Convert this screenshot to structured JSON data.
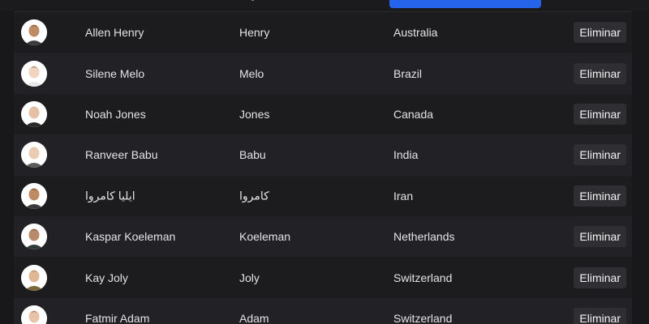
{
  "table": {
    "rows": [
      {
        "name": "Allen Henry",
        "last_name": "Henry",
        "country": "Australia",
        "delete_label": "Eliminar",
        "avatar": {
          "skin": "#c08a62",
          "hair": "#1a1a1a",
          "shirt": "#3a3a3a",
          "bg": "#ffffff"
        }
      },
      {
        "name": "Silene Melo",
        "last_name": "Melo",
        "country": "Brazil",
        "delete_label": "Eliminar",
        "avatar": {
          "skin": "#f1d3bf",
          "hair": "#141414",
          "shirt": "#e8e8e8",
          "bg": "#ffffff"
        }
      },
      {
        "name": "Noah Jones",
        "last_name": "Jones",
        "country": "Canada",
        "delete_label": "Eliminar",
        "avatar": {
          "skin": "#e6c0a4",
          "hair": "#b9b2a8",
          "shirt": "#2a2a2a",
          "bg": "#ffffff"
        }
      },
      {
        "name": "Ranveer Babu",
        "last_name": "Babu",
        "country": "India",
        "delete_label": "Eliminar",
        "avatar": {
          "skin": "#eccbb3",
          "hair": "#c9b99f",
          "shirt": "#5a5a5a",
          "bg": "#ffffff"
        }
      },
      {
        "name": "ايليا كامروا",
        "last_name": "كامروا",
        "country": "Iran",
        "delete_label": "Eliminar",
        "avatar": {
          "skin": "#c08a62",
          "hair": "#1a1a1a",
          "shirt": "#3a3a3a",
          "bg": "#ffffff"
        }
      },
      {
        "name": "Kaspar Koeleman",
        "last_name": "Koeleman",
        "country": "Netherlands",
        "delete_label": "Eliminar",
        "avatar": {
          "skin": "#b98a6c",
          "hair": "#2a2118",
          "shirt": "#2e3a33",
          "bg": "#ffffff"
        }
      },
      {
        "name": "Kay Joly",
        "last_name": "Joly",
        "country": "Switzerland",
        "delete_label": "Eliminar",
        "avatar": {
          "skin": "#e0b896",
          "hair": "#5a5a36",
          "shirt": "#7a6a3a",
          "bg": "#ffffff"
        }
      },
      {
        "name": "Fatmir Adam",
        "last_name": "Adam",
        "country": "Switzerland",
        "delete_label": "Eliminar",
        "avatar": {
          "skin": "#e8c3a6",
          "hair": "#3a2a20",
          "shirt": "#b84a4a",
          "bg": "#ffffff"
        }
      }
    ]
  }
}
